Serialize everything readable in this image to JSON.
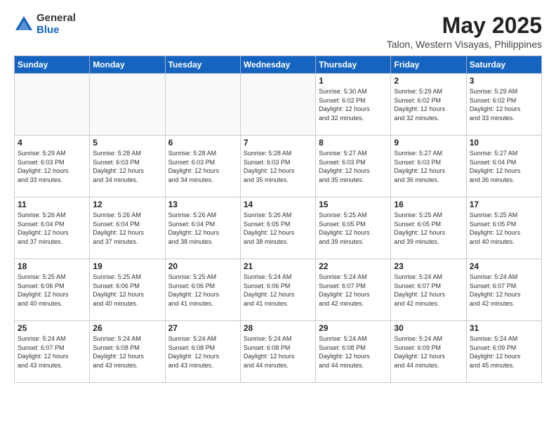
{
  "logo": {
    "general": "General",
    "blue": "Blue"
  },
  "title": "May 2025",
  "subtitle": "Talon, Western Visayas, Philippines",
  "weekdays": [
    "Sunday",
    "Monday",
    "Tuesday",
    "Wednesday",
    "Thursday",
    "Friday",
    "Saturday"
  ],
  "weeks": [
    [
      {
        "day": "",
        "info": ""
      },
      {
        "day": "",
        "info": ""
      },
      {
        "day": "",
        "info": ""
      },
      {
        "day": "",
        "info": ""
      },
      {
        "day": "1",
        "info": "Sunrise: 5:30 AM\nSunset: 6:02 PM\nDaylight: 12 hours\nand 32 minutes."
      },
      {
        "day": "2",
        "info": "Sunrise: 5:29 AM\nSunset: 6:02 PM\nDaylight: 12 hours\nand 32 minutes."
      },
      {
        "day": "3",
        "info": "Sunrise: 5:29 AM\nSunset: 6:02 PM\nDaylight: 12 hours\nand 33 minutes."
      }
    ],
    [
      {
        "day": "4",
        "info": "Sunrise: 5:29 AM\nSunset: 6:03 PM\nDaylight: 12 hours\nand 33 minutes."
      },
      {
        "day": "5",
        "info": "Sunrise: 5:28 AM\nSunset: 6:03 PM\nDaylight: 12 hours\nand 34 minutes."
      },
      {
        "day": "6",
        "info": "Sunrise: 5:28 AM\nSunset: 6:03 PM\nDaylight: 12 hours\nand 34 minutes."
      },
      {
        "day": "7",
        "info": "Sunrise: 5:28 AM\nSunset: 6:03 PM\nDaylight: 12 hours\nand 35 minutes."
      },
      {
        "day": "8",
        "info": "Sunrise: 5:27 AM\nSunset: 6:03 PM\nDaylight: 12 hours\nand 35 minutes."
      },
      {
        "day": "9",
        "info": "Sunrise: 5:27 AM\nSunset: 6:03 PM\nDaylight: 12 hours\nand 36 minutes."
      },
      {
        "day": "10",
        "info": "Sunrise: 5:27 AM\nSunset: 6:04 PM\nDaylight: 12 hours\nand 36 minutes."
      }
    ],
    [
      {
        "day": "11",
        "info": "Sunrise: 5:26 AM\nSunset: 6:04 PM\nDaylight: 12 hours\nand 37 minutes."
      },
      {
        "day": "12",
        "info": "Sunrise: 5:26 AM\nSunset: 6:04 PM\nDaylight: 12 hours\nand 37 minutes."
      },
      {
        "day": "13",
        "info": "Sunrise: 5:26 AM\nSunset: 6:04 PM\nDaylight: 12 hours\nand 38 minutes."
      },
      {
        "day": "14",
        "info": "Sunrise: 5:26 AM\nSunset: 6:05 PM\nDaylight: 12 hours\nand 38 minutes."
      },
      {
        "day": "15",
        "info": "Sunrise: 5:25 AM\nSunset: 6:05 PM\nDaylight: 12 hours\nand 39 minutes."
      },
      {
        "day": "16",
        "info": "Sunrise: 5:25 AM\nSunset: 6:05 PM\nDaylight: 12 hours\nand 39 minutes."
      },
      {
        "day": "17",
        "info": "Sunrise: 5:25 AM\nSunset: 6:05 PM\nDaylight: 12 hours\nand 40 minutes."
      }
    ],
    [
      {
        "day": "18",
        "info": "Sunrise: 5:25 AM\nSunset: 6:06 PM\nDaylight: 12 hours\nand 40 minutes."
      },
      {
        "day": "19",
        "info": "Sunrise: 5:25 AM\nSunset: 6:06 PM\nDaylight: 12 hours\nand 40 minutes."
      },
      {
        "day": "20",
        "info": "Sunrise: 5:25 AM\nSunset: 6:06 PM\nDaylight: 12 hours\nand 41 minutes."
      },
      {
        "day": "21",
        "info": "Sunrise: 5:24 AM\nSunset: 6:06 PM\nDaylight: 12 hours\nand 41 minutes."
      },
      {
        "day": "22",
        "info": "Sunrise: 5:24 AM\nSunset: 6:07 PM\nDaylight: 12 hours\nand 42 minutes."
      },
      {
        "day": "23",
        "info": "Sunrise: 5:24 AM\nSunset: 6:07 PM\nDaylight: 12 hours\nand 42 minutes."
      },
      {
        "day": "24",
        "info": "Sunrise: 5:24 AM\nSunset: 6:07 PM\nDaylight: 12 hours\nand 42 minutes."
      }
    ],
    [
      {
        "day": "25",
        "info": "Sunrise: 5:24 AM\nSunset: 6:07 PM\nDaylight: 12 hours\nand 43 minutes."
      },
      {
        "day": "26",
        "info": "Sunrise: 5:24 AM\nSunset: 6:08 PM\nDaylight: 12 hours\nand 43 minutes."
      },
      {
        "day": "27",
        "info": "Sunrise: 5:24 AM\nSunset: 6:08 PM\nDaylight: 12 hours\nand 43 minutes."
      },
      {
        "day": "28",
        "info": "Sunrise: 5:24 AM\nSunset: 6:08 PM\nDaylight: 12 hours\nand 44 minutes."
      },
      {
        "day": "29",
        "info": "Sunrise: 5:24 AM\nSunset: 6:08 PM\nDaylight: 12 hours\nand 44 minutes."
      },
      {
        "day": "30",
        "info": "Sunrise: 5:24 AM\nSunset: 6:09 PM\nDaylight: 12 hours\nand 44 minutes."
      },
      {
        "day": "31",
        "info": "Sunrise: 5:24 AM\nSunset: 6:09 PM\nDaylight: 12 hours\nand 45 minutes."
      }
    ]
  ]
}
